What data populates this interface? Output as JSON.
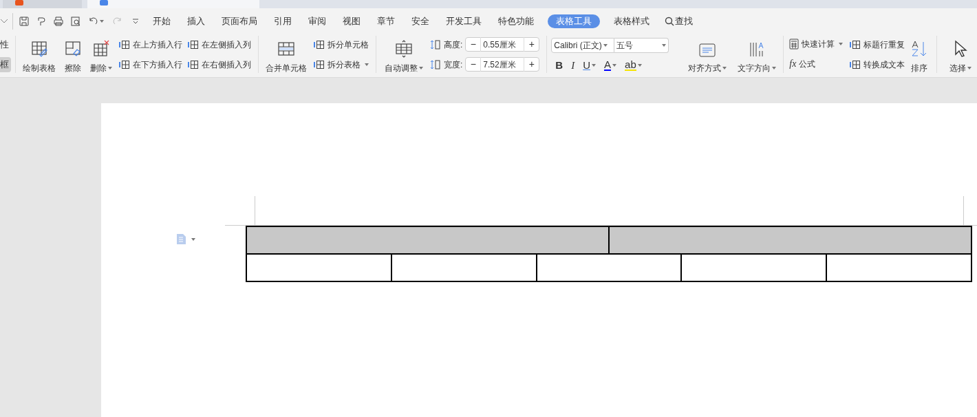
{
  "doc_tabs": [
    {
      "selected": false
    },
    {
      "selected": true
    }
  ],
  "menu_tabs": [
    {
      "label": "开始",
      "selected": false
    },
    {
      "label": "插入",
      "selected": false
    },
    {
      "label": "页面布局",
      "selected": false
    },
    {
      "label": "引用",
      "selected": false
    },
    {
      "label": "审阅",
      "selected": false
    },
    {
      "label": "视图",
      "selected": false
    },
    {
      "label": "章节",
      "selected": false
    },
    {
      "label": "安全",
      "selected": false
    },
    {
      "label": "开发工具",
      "selected": false
    },
    {
      "label": "特色功能",
      "selected": false
    },
    {
      "label": "表格工具",
      "selected": true
    },
    {
      "label": "表格样式",
      "selected": false
    }
  ],
  "search": {
    "label": "查找"
  },
  "left_cut": [
    {
      "label": "性",
      "selected": false
    },
    {
      "label": "框",
      "selected": true
    }
  ],
  "ribbon": {
    "draw_tools": [
      {
        "label": "绘制表格",
        "has_menu": false
      },
      {
        "label": "擦除",
        "has_menu": false
      },
      {
        "label": "删除",
        "has_menu": true
      }
    ],
    "insert": [
      "在上方插入行",
      "在左侧插入列",
      "在下方插入行",
      "在右侧插入列"
    ],
    "merge": {
      "label": "合并单元格"
    },
    "split": [
      {
        "label": "拆分单元格",
        "has_menu": false
      },
      {
        "label": "拆分表格",
        "has_menu": true
      }
    ],
    "autofit": {
      "label": "自动调整",
      "has_menu": true
    },
    "size": [
      {
        "label": "高度:",
        "value": "0.55厘米",
        "minus": "−",
        "plus": "+"
      },
      {
        "label": "宽度:",
        "value": "7.52厘米",
        "minus": "−",
        "plus": "+"
      }
    ],
    "font": {
      "name": "Calibri (正文)",
      "size": "五号"
    },
    "format": [
      {
        "label": "B",
        "kind": "bold"
      },
      {
        "label": "I",
        "kind": "italic"
      },
      {
        "label": "U",
        "kind": "underline"
      },
      {
        "label": "A",
        "kind": "color"
      },
      {
        "label": "ab",
        "kind": "highlight"
      }
    ],
    "align": {
      "label": "对齐方式"
    },
    "direction": {
      "label": "文字方向"
    },
    "calc": [
      {
        "label": "快速计算",
        "has_menu": true
      },
      {
        "label": "公式",
        "has_menu": false,
        "icon": "fx"
      }
    ],
    "repeat": [
      {
        "label": "标题行重复"
      },
      {
        "label": "转换成文本"
      }
    ],
    "sort": {
      "label": "排序"
    },
    "select": {
      "label": "选择",
      "has_menu": true
    }
  },
  "table": {
    "rows": [
      {
        "cells": [
          {
            "shaded": true
          },
          {
            "shaded": true
          }
        ]
      },
      {
        "cells": [
          {
            "shaded": false
          },
          {
            "shaded": false
          },
          {
            "shaded": false
          },
          {
            "shaded": false
          },
          {
            "shaded": false
          }
        ]
      }
    ]
  }
}
